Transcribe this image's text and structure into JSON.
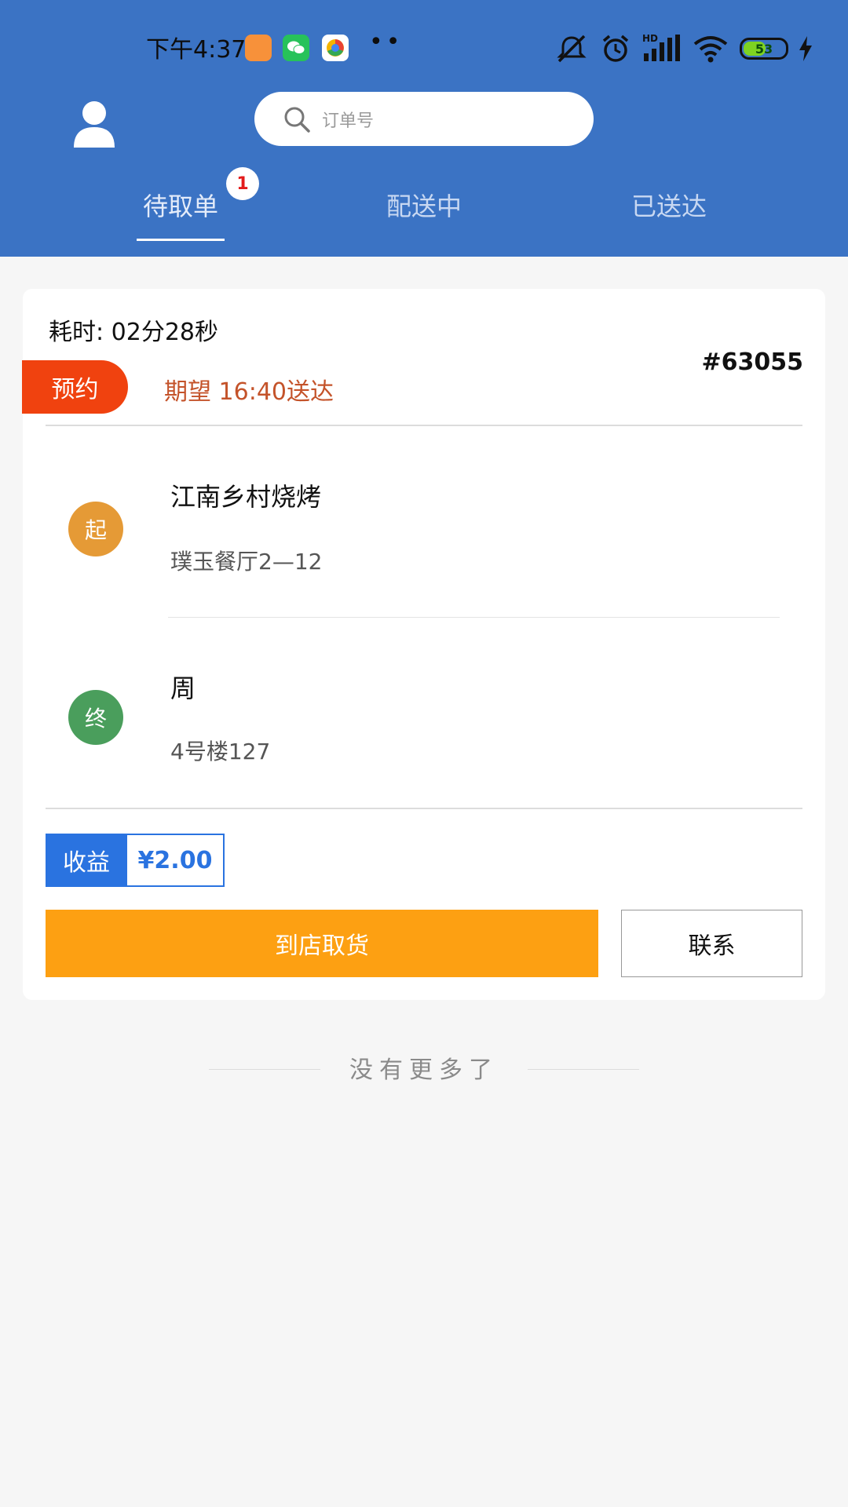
{
  "status_bar": {
    "time": "下午4:37",
    "dots": "••",
    "battery_percent": "53",
    "signal_label": "HD",
    "icons": [
      "app-orange-icon",
      "wechat-icon",
      "browser-icon",
      "mute-icon",
      "alarm-icon",
      "signal-icon",
      "wifi-icon",
      "battery-icon",
      "charging-icon"
    ]
  },
  "header": {
    "search_placeholder": "订单号",
    "tabs": [
      {
        "label": "待取单",
        "active": true,
        "badge": "1"
      },
      {
        "label": "配送中",
        "active": false
      },
      {
        "label": "已送达",
        "active": false
      }
    ],
    "colors": {
      "header_bg": "#3b73c4"
    }
  },
  "order": {
    "elapsed": "耗时: 02分28秒",
    "order_no": "#63055",
    "reserve_tag": "预约",
    "expected": "期望 16:40送达",
    "start_marker": "起",
    "start_name": "江南乡村烧烤",
    "start_address": "璞玉餐厅2—12",
    "end_marker": "终",
    "end_name": "周",
    "end_address": "4号楼127",
    "earn_label": "收益",
    "earn_value": "¥2.00",
    "pickup_button": "到店取货",
    "contact_button": "联系",
    "colors": {
      "reserve": "#f0420f",
      "pickup": "#fda012",
      "earn": "#2a73e0",
      "start": "#e59a36",
      "end": "#4a9e5c"
    }
  },
  "footer": {
    "no_more": "没有更多了"
  }
}
